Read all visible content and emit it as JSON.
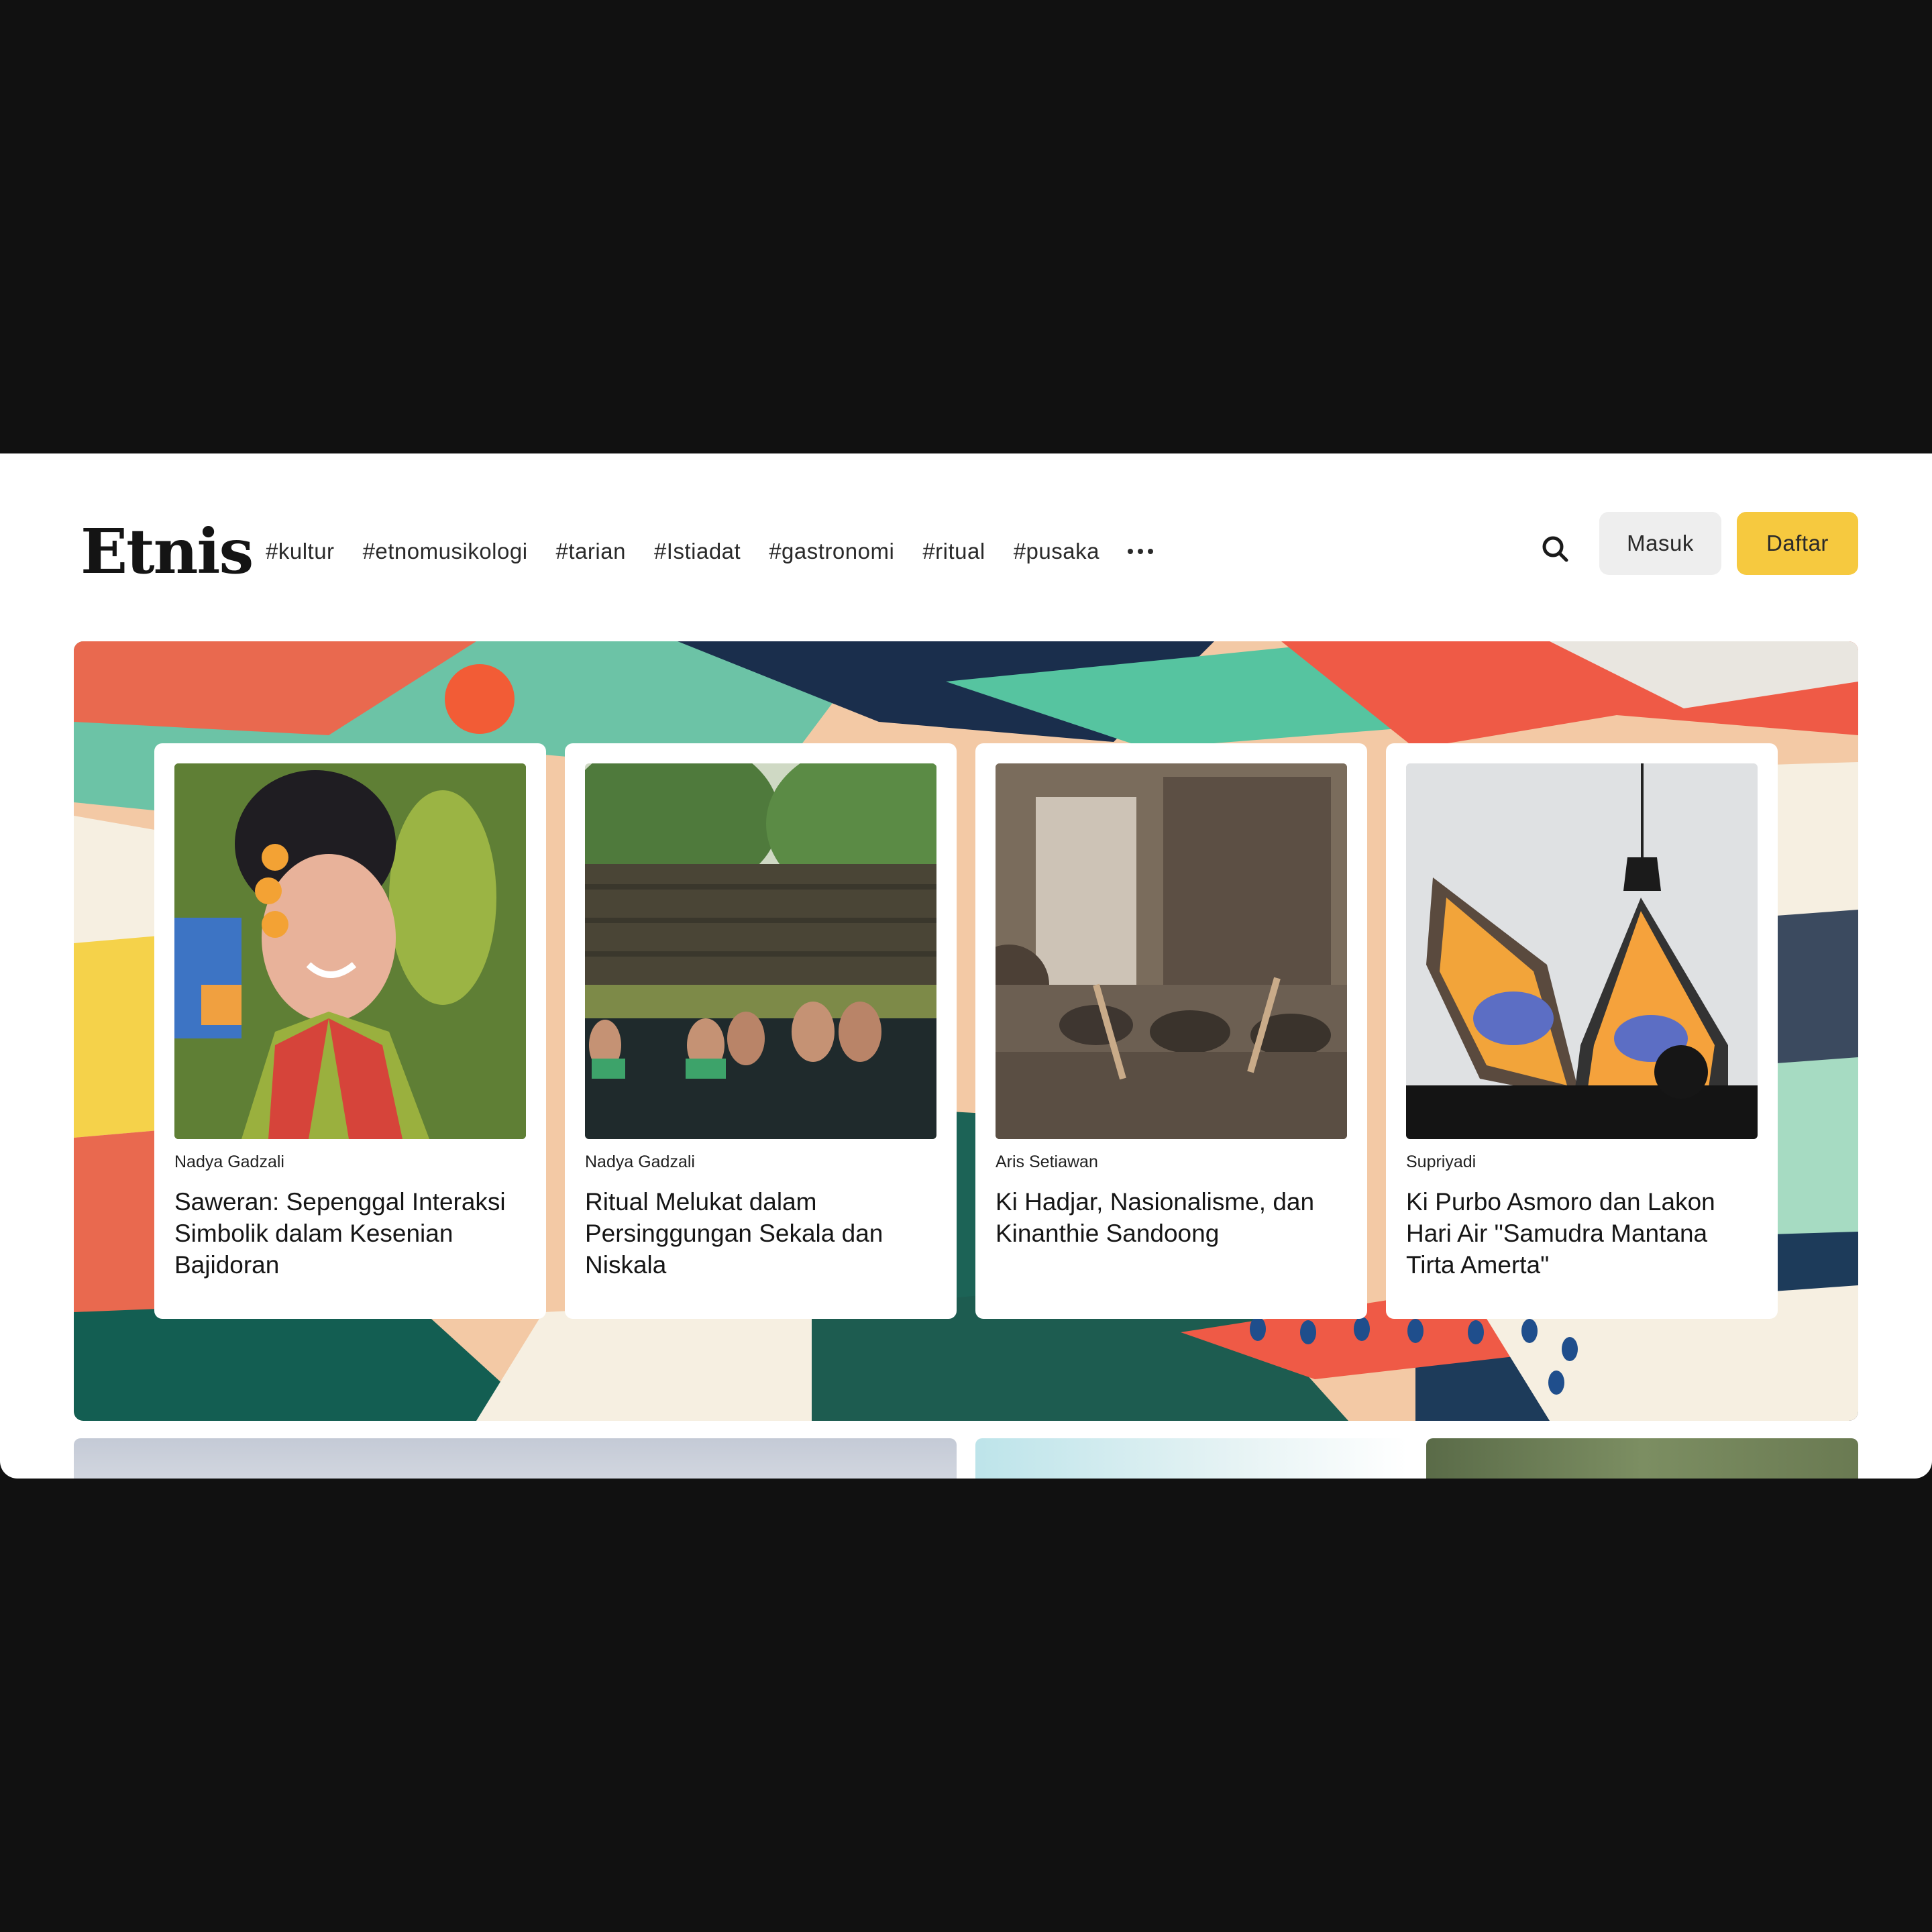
{
  "header": {
    "logo_text": "Etnis",
    "nav_items": [
      "#kultur",
      "#etnomusikologi",
      "#tarian",
      "#Istiadat",
      "#gastronomi",
      "#ritual",
      "#pusaka"
    ],
    "more_icon": "ellipsis-icon",
    "search_icon": "search-icon",
    "login_label": "Masuk",
    "register_label": "Daftar"
  },
  "colors": {
    "accent": "#f6c93f",
    "page_background": "#111111",
    "surface": "#ffffff"
  },
  "featured": [
    {
      "author": "Nadya Gadzali",
      "title": "Saweran: Sepenggal Interaksi Simbolik dalam Kesenian Bajidoran"
    },
    {
      "author": "Nadya Gadzali",
      "title": "Ritual Melukat dalam Persinggungan Sekala dan Niskala"
    },
    {
      "author": "Aris Setiawan",
      "title": "Ki Hadjar, Nasionalisme, dan Kinanthie Sandoong"
    },
    {
      "author": "Supriyadi",
      "title": "Ki Purbo Asmoro dan Lakon Hari Air \"Samudra Mantana Tirta Amerta\""
    }
  ]
}
